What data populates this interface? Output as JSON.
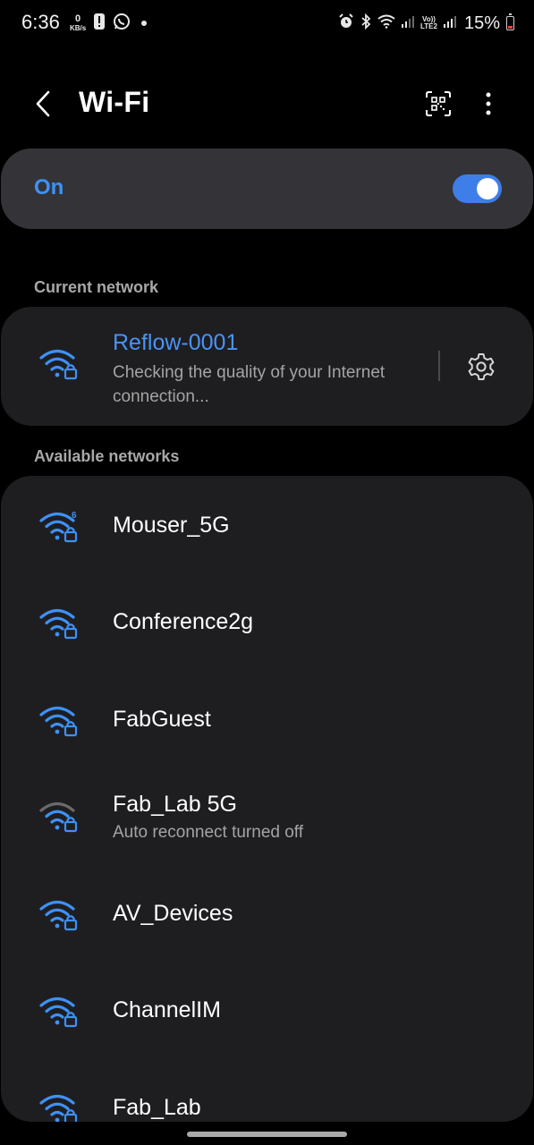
{
  "status_bar": {
    "time": "6:36",
    "net_speed_value": "0",
    "net_speed_unit": "KB/s",
    "volte_top": "Vo))",
    "volte_bottom": "LTE2",
    "battery_percent": "15%"
  },
  "header": {
    "title": "Wi-Fi"
  },
  "wifi_toggle": {
    "label": "On",
    "enabled": true
  },
  "current_section": {
    "title": "Current network",
    "network": {
      "name": "Reflow-0001",
      "status": "Checking the quality of your Internet connection..."
    }
  },
  "available_section": {
    "title": "Available networks",
    "networks": [
      {
        "name": "Mouser_5G",
        "subtitle": "",
        "icon": "wifi-6-lock-icon"
      },
      {
        "name": "Conference2g",
        "subtitle": "",
        "icon": "wifi-lock-icon"
      },
      {
        "name": "FabGuest",
        "subtitle": "",
        "icon": "wifi-lock-icon"
      },
      {
        "name": "Fab_Lab 5G",
        "subtitle": "Auto reconnect turned off",
        "icon": "wifi-lock-weak-icon"
      },
      {
        "name": "AV_Devices",
        "subtitle": "",
        "icon": "wifi-lock-icon"
      },
      {
        "name": "ChannelIM",
        "subtitle": "",
        "icon": "wifi-lock-icon"
      },
      {
        "name": "Fab_Lab",
        "subtitle": "",
        "icon": "wifi-lock-icon"
      }
    ]
  },
  "colors": {
    "accent": "#3e91f7",
    "toggle_track": "#3e7ee8",
    "card_bg": "#1e1e21",
    "toggle_card_bg": "#343438",
    "secondary_text": "#a4a4a4"
  }
}
